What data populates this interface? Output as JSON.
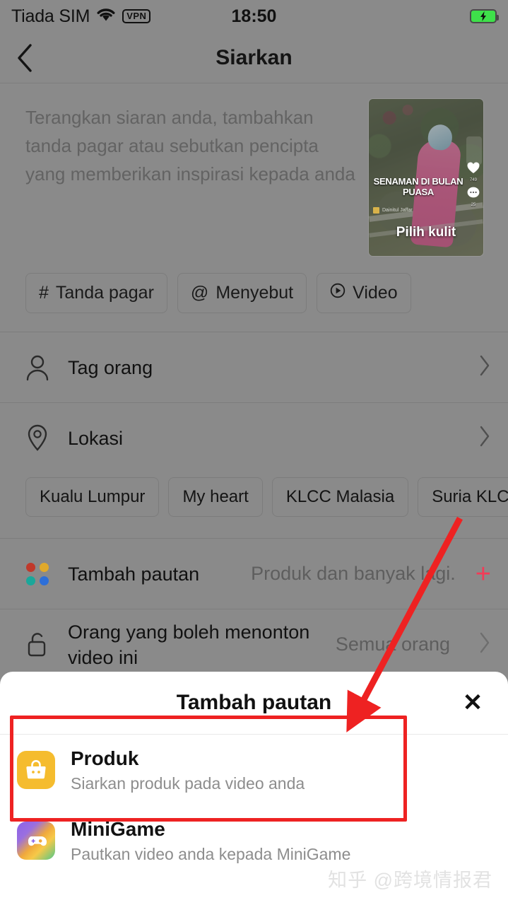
{
  "status_bar": {
    "carrier": "Tiada SIM",
    "vpn_badge": "VPN",
    "time": "18:50",
    "wifi_icon": "wifi-icon",
    "battery_icon": "battery-charging-icon"
  },
  "nav": {
    "back_icon": "chevron-left-icon",
    "title": "Siarkan"
  },
  "caption": {
    "placeholder": "Terangkan siaran anda, tambahkan tanda pagar atau sebutkan pencipta yang memberikan inspirasi kepada anda"
  },
  "thumbnail": {
    "overlay_title": "SENAMAN DI BULAN PUASA",
    "author": "Dainitul Jaffar",
    "cover_label": "Pilih kulit",
    "like_count": "749",
    "comment_count": "25",
    "heart_icon": "heart-icon",
    "comment_icon": "comment-icon"
  },
  "chips": [
    {
      "icon": "hashtag-icon",
      "glyph": "#",
      "label": "Tanda pagar"
    },
    {
      "icon": "at-icon",
      "glyph": "@",
      "label": "Menyebut"
    },
    {
      "icon": "play-circle-icon",
      "glyph": "▶",
      "label": "Video"
    }
  ],
  "rows": {
    "tag_people": {
      "icon": "person-icon",
      "label": "Tag orang",
      "chevron": "chevron-right-icon"
    },
    "location": {
      "icon": "location-pin-icon",
      "label": "Lokasi",
      "chevron": "chevron-right-icon"
    },
    "add_link": {
      "icon": "four-dots-icon",
      "label": "Tambah pautan",
      "value": "Produk dan banyak lagi.",
      "plus": "+",
      "plus_color": "#f23b57",
      "dot_colors": [
        "#c0392b",
        "#e0a92b",
        "#1aa79a",
        "#2d6fd8"
      ]
    },
    "privacy": {
      "icon": "unlock-icon",
      "label": "Orang yang boleh menonton video ini",
      "value": "Semua orang",
      "chevron": "chevron-right-icon"
    }
  },
  "location_chips": [
    "Kualu Lumpur",
    "My heart",
    "KLCC Malasia",
    "Suria KLCC Sdn B"
  ],
  "sheet": {
    "title": "Tambah pautan",
    "close_icon": "close-icon",
    "close_glyph": "✕",
    "items": [
      {
        "icon": "shopping-bag-icon",
        "title": "Produk",
        "subtitle": "Siarkan produk pada video anda",
        "icon_color": "#f5bc2e"
      },
      {
        "icon": "gamepad-icon",
        "title": "MiniGame",
        "subtitle": "Pautkan video anda kepada MiniGame",
        "icon_color": "#8b62e8"
      }
    ]
  },
  "annotation": {
    "highlight_color": "#ee2222",
    "arrow": "red-arrow-pointing-to-produk"
  },
  "watermark": "知乎 @跨境情报君"
}
